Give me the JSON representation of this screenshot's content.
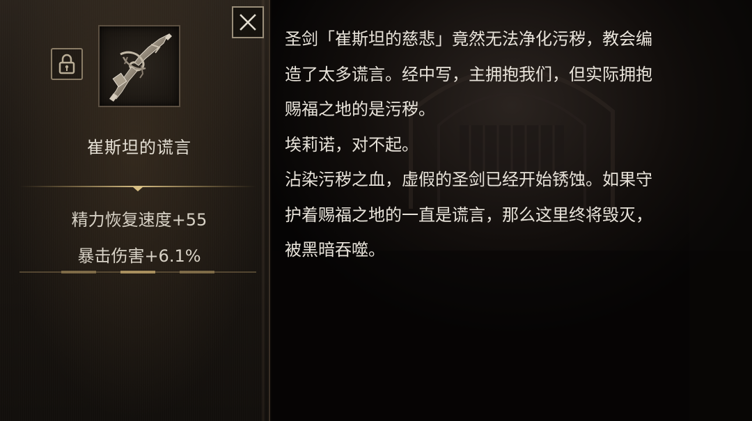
{
  "item": {
    "name": "崔斯坦的谎言",
    "locked": true,
    "icon": "rusted-broken-sword-relic-icon"
  },
  "stats": [
    "精力恢复速度+55",
    "暴击伤害+6.1%"
  ],
  "description": {
    "lines": [
      "圣剑「崔斯坦的慈悲」竟然无法净化污秽，教会编",
      "造了太多谎言。经中写，主拥抱我们，但实际拥抱",
      "赐福之地的是污秽。",
      "埃莉诺，对不起。",
      "沾染污秽之血，虚假的圣剑已经开始锈蚀。如果守",
      "护着赐福之地的一直是谎言，那么这里终将毁灭，",
      "被黑暗吞噬。"
    ]
  },
  "controls": {
    "close_icon": "close-icon",
    "lock_icon": "lock-icon"
  },
  "colors": {
    "panel_border": "#8a7c66",
    "divider_gold": "#b79a5c",
    "text": "#e8e3da"
  }
}
